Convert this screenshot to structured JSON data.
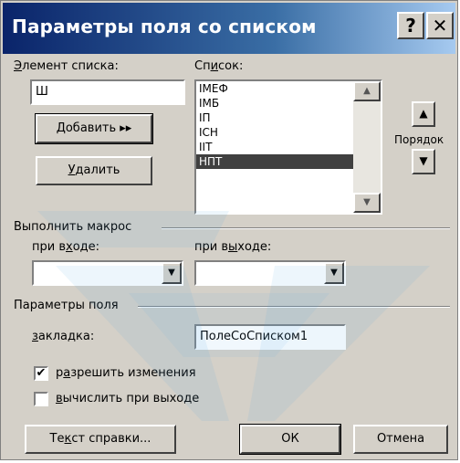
{
  "dialog": {
    "title": "Параметры поля со списком",
    "help_glyph": "?",
    "close_glyph": "✕"
  },
  "list_item_field": {
    "label_prefix": "",
    "label_hotkey": "Э",
    "label_rest": "лемент списка:",
    "value": "Ш"
  },
  "buttons": {
    "add_hotkey": "Д",
    "add_rest": "обавить ▸▸",
    "remove_hotkey": "У",
    "remove_rest": "далить",
    "help_prefix": "Те",
    "help_hotkey": "к",
    "help_rest": "ст справки...",
    "ok": "ОК",
    "cancel": "Отмена"
  },
  "list": {
    "label_prefix": "Сп",
    "label_hotkey": "и",
    "label_rest": "сок:",
    "items": [
      "IMEФ",
      "IMБ",
      "IП",
      "IСН",
      "IIТ",
      "НПТ"
    ],
    "selected_index": 5,
    "scroll_up": "▲",
    "scroll_down": "▼"
  },
  "order": {
    "label": "Порядок",
    "up_glyph": "▲",
    "down_glyph": "▼"
  },
  "macro_group": {
    "title": "Выполнить макрос",
    "on_enter_prefix": "при в",
    "on_enter_hotkey": "х",
    "on_enter_rest": "оде:",
    "on_exit_prefix": "при в",
    "on_exit_hotkey": "ы",
    "on_exit_rest": "ходе:",
    "combo_arrow": "▼"
  },
  "field_group": {
    "title": "Параметры поля",
    "bookmark_prefix": "",
    "bookmark_hotkey": "з",
    "bookmark_rest": "акладка:",
    "bookmark_value": "ПолеСоСписком1",
    "allow_changes_prefix": "р",
    "allow_changes_hotkey": "а",
    "allow_changes_rest": "зрешить изменения",
    "allow_changes_checked": true,
    "calc_on_exit_prefix": "",
    "calc_on_exit_hotkey": "в",
    "calc_on_exit_rest": "ычислить при выходе",
    "calc_on_exit_checked": false,
    "check_glyph": "✔"
  },
  "colors": {
    "title_gradient_start": "#0a246a",
    "dialog_face": "#d4d0c8",
    "selection": "#404040"
  }
}
